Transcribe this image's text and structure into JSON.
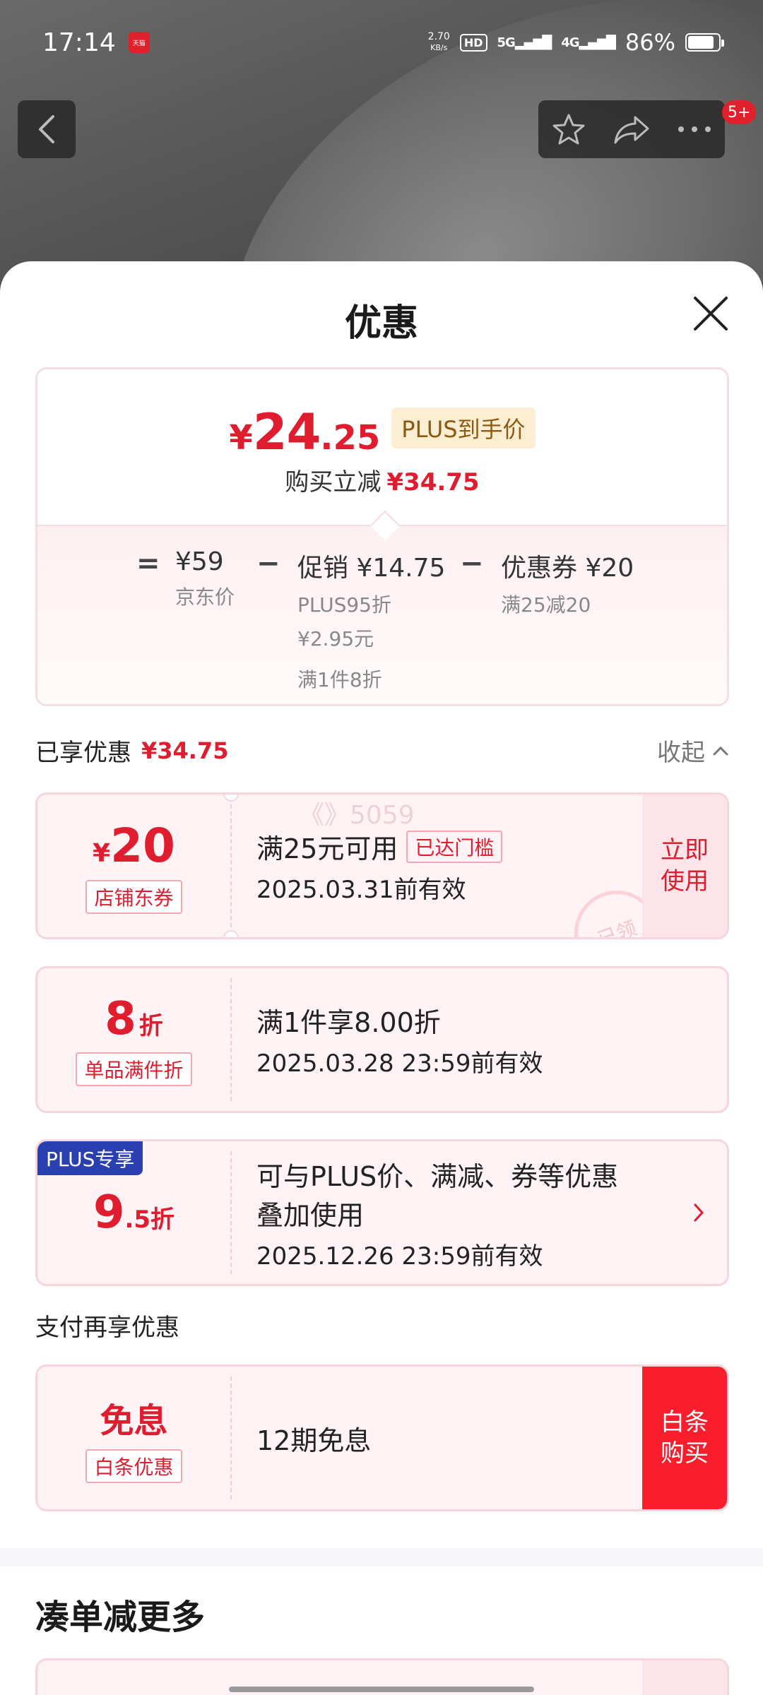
{
  "status_bar": {
    "time": "17:14",
    "app_badge": "天猫",
    "net_speed_value": "2.70",
    "net_speed_unit": "KB/s",
    "hd_label": "HD",
    "sim1_label": "5G",
    "sim2_label": "4G",
    "battery_pct": "86%",
    "battery_level": 0.86
  },
  "nav": {
    "badge_count": "5+"
  },
  "sheet": {
    "title": "优惠",
    "summary": {
      "price_currency": "¥",
      "price_int": "24",
      "price_dec": ".25",
      "plus_tag": "PLUS到手价",
      "reduce_label": "购买立减",
      "reduce_amount": "¥34.75",
      "formula": {
        "equals": "=",
        "jd_price": "¥59",
        "jd_price_label": "京东价",
        "minus1": "−",
        "promo": "促销 ¥14.75",
        "promo_sub1": "PLUS95折",
        "promo_sub2": "¥2.95元",
        "promo_sub3": "满1件8折",
        "minus2": "−",
        "coupon": "优惠券 ¥20",
        "coupon_sub": "满25减20"
      }
    },
    "enjoyed": {
      "label": "已享优惠",
      "amount": "¥34.75",
      "collapse_label": "收起"
    },
    "coupons": [
      {
        "currency": "¥",
        "value": "20",
        "unit": "",
        "tag": "店铺东券",
        "line1": "满25元可用",
        "cond_tag": "已达门槛",
        "line2": "2025.03.31前有效",
        "action_line1": "立即",
        "action_line2": "使用",
        "watermark": "《》5059",
        "stamp": "已领"
      },
      {
        "value": "8",
        "unit": "折",
        "tag": "单品满件折",
        "line1": "满1件享8.00折",
        "line2": "2025.03.28 23:59前有效"
      },
      {
        "corner": "PLUS专享",
        "value": "9",
        "unit": ".5折",
        "line1": "可与PLUS价、满减、券等优惠",
        "line1b": "叠加使用",
        "line2": "2025.12.26 23:59前有效"
      }
    ],
    "pay_section": {
      "label": "支付再享优惠",
      "card": {
        "value": "免息",
        "tag": "白条优惠",
        "line1": "12期免息",
        "action_line1": "白条",
        "action_line2": "购买"
      }
    },
    "more_title": "凑单减更多"
  },
  "colors": {
    "accent_red": "#e01d2e",
    "plus_blue": "#2a3fb0",
    "plus_gold_bg": "#fbeed3",
    "card_bg": "#fff3f5",
    "baitiao_red": "#fa1e2d"
  }
}
